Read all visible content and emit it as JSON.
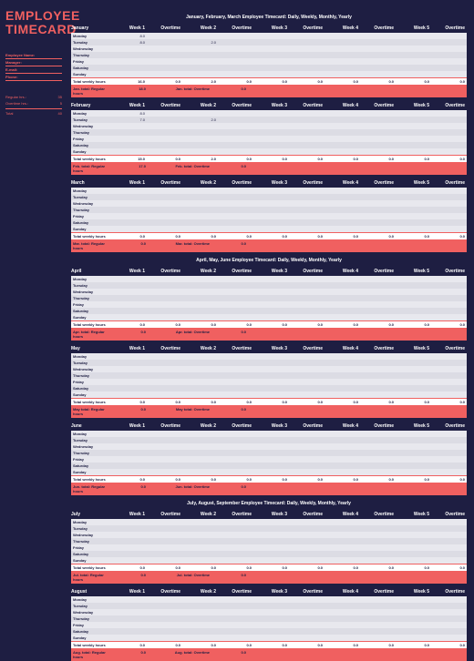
{
  "sidebar": {
    "title1": "EMPLOYEE",
    "title2": "TIMECARD",
    "meta": [
      {
        "label": "Employee Name:",
        "value": ""
      },
      {
        "label": "Manager:",
        "value": ""
      },
      {
        "label": "E-mail:",
        "value": ""
      },
      {
        "label": "Phone:",
        "value": ""
      }
    ],
    "totals": {
      "regular_label": "Regular hrs.:",
      "regular_value": "35",
      "overtime_label": "Overtime hrs.:",
      "overtime_value": "5",
      "total_label": "Total",
      "total_value": "40"
    }
  },
  "columns": [
    "Week 1",
    "Overtime",
    "Week 2",
    "Overtime",
    "Week 3",
    "Overtime",
    "Week 4",
    "Overtime",
    "Week 5",
    "Overtime"
  ],
  "days": [
    "Monday",
    "Tuesday",
    "Wednesday",
    "Thursday",
    "Friday",
    "Saturday",
    "Sunday"
  ],
  "labels": {
    "total_weekly": "Total weekly hours",
    "regular_hours_suffix": "total: Regular hours",
    "overtime_suffix": "total: Overtime"
  },
  "sections": [
    {
      "title": "January, February, March      Employee Timecard: Daily, Weekly, Monthly, Yearly",
      "months": [
        {
          "name": "January",
          "short": "Jan.",
          "rows": [
            [
              "8.0",
              "",
              "",
              "",
              "",
              "",
              "",
              "",
              "",
              ""
            ],
            [
              "8.0",
              "",
              "2.0",
              "",
              "",
              "",
              "",
              "",
              "",
              ""
            ],
            [
              "",
              "",
              "",
              "",
              "",
              "",
              "",
              "",
              "",
              ""
            ],
            [
              "",
              "",
              "",
              "",
              "",
              "",
              "",
              "",
              "",
              ""
            ],
            [
              "",
              "",
              "",
              "",
              "",
              "",
              "",
              "",
              "",
              ""
            ],
            [
              "",
              "",
              "",
              "",
              "",
              "",
              "",
              "",
              "",
              ""
            ],
            [
              "",
              "",
              "",
              "",
              "",
              "",
              "",
              "",
              "",
              ""
            ]
          ],
          "weekly": [
            "16.0",
            "0.0",
            "2.0",
            "0.0",
            "0.0",
            "0.0",
            "0.0",
            "0.0",
            "0.0",
            "0.0"
          ],
          "reg": "18.0",
          "ot": "0.0"
        },
        {
          "name": "February",
          "short": "Feb.",
          "rows": [
            [
              "8.0",
              "",
              "",
              "",
              "",
              "",
              "",
              "",
              "",
              ""
            ],
            [
              "7.0",
              "",
              "2.0",
              "",
              "",
              "",
              "",
              "",
              "",
              ""
            ],
            [
              "",
              "",
              "",
              "",
              "",
              "",
              "",
              "",
              "",
              ""
            ],
            [
              "",
              "",
              "",
              "",
              "",
              "",
              "",
              "",
              "",
              ""
            ],
            [
              "",
              "",
              "",
              "",
              "",
              "",
              "",
              "",
              "",
              ""
            ],
            [
              "",
              "",
              "",
              "",
              "",
              "",
              "",
              "",
              "",
              ""
            ],
            [
              "",
              "",
              "",
              "",
              "",
              "",
              "",
              "",
              "",
              ""
            ]
          ],
          "weekly": [
            "15.0",
            "0.0",
            "2.0",
            "0.0",
            "0.0",
            "0.0",
            "0.0",
            "0.0",
            "0.0",
            "0.0"
          ],
          "reg": "17.0",
          "ot": "0.0"
        },
        {
          "name": "March",
          "short": "Mar.",
          "rows": [
            [
              "",
              "",
              "",
              "",
              "",
              "",
              "",
              "",
              "",
              ""
            ],
            [
              "",
              "",
              "",
              "",
              "",
              "",
              "",
              "",
              "",
              ""
            ],
            [
              "",
              "",
              "",
              "",
              "",
              "",
              "",
              "",
              "",
              ""
            ],
            [
              "",
              "",
              "",
              "",
              "",
              "",
              "",
              "",
              "",
              ""
            ],
            [
              "",
              "",
              "",
              "",
              "",
              "",
              "",
              "",
              "",
              ""
            ],
            [
              "",
              "",
              "",
              "",
              "",
              "",
              "",
              "",
              "",
              ""
            ],
            [
              "",
              "",
              "",
              "",
              "",
              "",
              "",
              "",
              "",
              ""
            ]
          ],
          "weekly": [
            "0.0",
            "0.0",
            "0.0",
            "0.0",
            "0.0",
            "0.0",
            "0.0",
            "0.0",
            "0.0",
            "0.0"
          ],
          "reg": "0.0",
          "ot": "0.0"
        }
      ]
    },
    {
      "title": "April, May, June      Employee Timecard: Daily, Weekly, Monthly, Yearly",
      "months": [
        {
          "name": "April",
          "short": "Apr.",
          "rows": [
            [
              "",
              "",
              "",
              "",
              "",
              "",
              "",
              "",
              "",
              ""
            ],
            [
              "",
              "",
              "",
              "",
              "",
              "",
              "",
              "",
              "",
              ""
            ],
            [
              "",
              "",
              "",
              "",
              "",
              "",
              "",
              "",
              "",
              ""
            ],
            [
              "",
              "",
              "",
              "",
              "",
              "",
              "",
              "",
              "",
              ""
            ],
            [
              "",
              "",
              "",
              "",
              "",
              "",
              "",
              "",
              "",
              ""
            ],
            [
              "",
              "",
              "",
              "",
              "",
              "",
              "",
              "",
              "",
              ""
            ],
            [
              "",
              "",
              "",
              "",
              "",
              "",
              "",
              "",
              "",
              ""
            ]
          ],
          "weekly": [
            "0.0",
            "0.0",
            "0.0",
            "0.0",
            "0.0",
            "0.0",
            "0.0",
            "0.0",
            "0.0",
            "0.0"
          ],
          "reg": "0.0",
          "ot": "0.0"
        },
        {
          "name": "May",
          "short": "May",
          "rows": [
            [
              "",
              "",
              "",
              "",
              "",
              "",
              "",
              "",
              "",
              ""
            ],
            [
              "",
              "",
              "",
              "",
              "",
              "",
              "",
              "",
              "",
              ""
            ],
            [
              "",
              "",
              "",
              "",
              "",
              "",
              "",
              "",
              "",
              ""
            ],
            [
              "",
              "",
              "",
              "",
              "",
              "",
              "",
              "",
              "",
              ""
            ],
            [
              "",
              "",
              "",
              "",
              "",
              "",
              "",
              "",
              "",
              ""
            ],
            [
              "",
              "",
              "",
              "",
              "",
              "",
              "",
              "",
              "",
              ""
            ],
            [
              "",
              "",
              "",
              "",
              "",
              "",
              "",
              "",
              "",
              ""
            ]
          ],
          "weekly": [
            "0.0",
            "0.0",
            "0.0",
            "0.0",
            "0.0",
            "0.0",
            "0.0",
            "0.0",
            "0.0",
            "0.0"
          ],
          "reg": "0.0",
          "ot": "0.0"
        },
        {
          "name": "June",
          "short": "Jun.",
          "rows": [
            [
              "",
              "",
              "",
              "",
              "",
              "",
              "",
              "",
              "",
              ""
            ],
            [
              "",
              "",
              "",
              "",
              "",
              "",
              "",
              "",
              "",
              ""
            ],
            [
              "",
              "",
              "",
              "",
              "",
              "",
              "",
              "",
              "",
              ""
            ],
            [
              "",
              "",
              "",
              "",
              "",
              "",
              "",
              "",
              "",
              ""
            ],
            [
              "",
              "",
              "",
              "",
              "",
              "",
              "",
              "",
              "",
              ""
            ],
            [
              "",
              "",
              "",
              "",
              "",
              "",
              "",
              "",
              "",
              ""
            ],
            [
              "",
              "",
              "",
              "",
              "",
              "",
              "",
              "",
              "",
              ""
            ]
          ],
          "weekly": [
            "0.0",
            "0.0",
            "0.0",
            "0.0",
            "0.0",
            "0.0",
            "0.0",
            "0.0",
            "0.0",
            "0.0"
          ],
          "reg": "0.0",
          "ot": "0.0"
        }
      ]
    },
    {
      "title": "July, August, September      Employee Timecard: Daily, Weekly, Monthly, Yearly",
      "months": [
        {
          "name": "July",
          "short": "Jul.",
          "rows": [
            [
              "",
              "",
              "",
              "",
              "",
              "",
              "",
              "",
              "",
              ""
            ],
            [
              "",
              "",
              "",
              "",
              "",
              "",
              "",
              "",
              "",
              ""
            ],
            [
              "",
              "",
              "",
              "",
              "",
              "",
              "",
              "",
              "",
              ""
            ],
            [
              "",
              "",
              "",
              "",
              "",
              "",
              "",
              "",
              "",
              ""
            ],
            [
              "",
              "",
              "",
              "",
              "",
              "",
              "",
              "",
              "",
              ""
            ],
            [
              "",
              "",
              "",
              "",
              "",
              "",
              "",
              "",
              "",
              ""
            ],
            [
              "",
              "",
              "",
              "",
              "",
              "",
              "",
              "",
              "",
              ""
            ]
          ],
          "weekly": [
            "0.0",
            "0.0",
            "0.0",
            "0.0",
            "0.0",
            "0.0",
            "0.0",
            "0.0",
            "0.0",
            "0.0"
          ],
          "reg": "0.0",
          "ot": "0.0"
        },
        {
          "name": "August",
          "short": "Aug.",
          "rows": [
            [
              "",
              "",
              "",
              "",
              "",
              "",
              "",
              "",
              "",
              ""
            ],
            [
              "",
              "",
              "",
              "",
              "",
              "",
              "",
              "",
              "",
              ""
            ],
            [
              "",
              "",
              "",
              "",
              "",
              "",
              "",
              "",
              "",
              ""
            ],
            [
              "",
              "",
              "",
              "",
              "",
              "",
              "",
              "",
              "",
              ""
            ],
            [
              "",
              "",
              "",
              "",
              "",
              "",
              "",
              "",
              "",
              ""
            ],
            [
              "",
              "",
              "",
              "",
              "",
              "",
              "",
              "",
              "",
              ""
            ],
            [
              "",
              "",
              "",
              "",
              "",
              "",
              "",
              "",
              "",
              ""
            ]
          ],
          "weekly": [
            "0.0",
            "0.0",
            "0.0",
            "0.0",
            "0.0",
            "0.0",
            "0.0",
            "0.0",
            "0.0",
            "0.0"
          ],
          "reg": "0.0",
          "ot": "0.0"
        }
      ]
    }
  ]
}
